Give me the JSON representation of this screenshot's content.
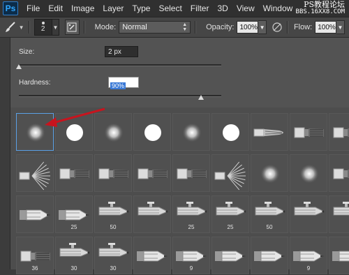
{
  "app": {
    "logo": "Ps"
  },
  "menu": [
    "File",
    "Edit",
    "Image",
    "Layer",
    "Type",
    "Select",
    "Filter",
    "3D",
    "View",
    "Window"
  ],
  "watermark": {
    "line1": "PS教程论坛",
    "line2": "BBS.16XX8.COM"
  },
  "options": {
    "brush_size": "2",
    "mode_label": "Mode:",
    "mode_value": "Normal",
    "opacity_label": "Opacity:",
    "opacity_value": "100%",
    "flow_label": "Flow:",
    "flow_value": "100%"
  },
  "brush_picker": {
    "size_label": "Size:",
    "size_value": "2 px",
    "size_slider_fraction": 0.0,
    "hardness_label": "Hardness:",
    "hardness_value": "90%",
    "hardness_slider_fraction": 0.9
  },
  "accent_colors": {
    "selection": "#3a79d6",
    "arrow": "#c8141e",
    "logo": "#31a8ff"
  },
  "brush_tiles": [
    {
      "kind": "soft",
      "label": "",
      "selected": true
    },
    {
      "kind": "hard",
      "label": ""
    },
    {
      "kind": "soft",
      "label": ""
    },
    {
      "kind": "hard",
      "label": ""
    },
    {
      "kind": "soft",
      "label": ""
    },
    {
      "kind": "hard",
      "label": ""
    },
    {
      "kind": "round-bristle",
      "label": ""
    },
    {
      "kind": "flat-bristle",
      "label": ""
    },
    {
      "kind": "flat-bristle",
      "label": ""
    },
    {
      "kind": "fan",
      "label": ""
    },
    {
      "kind": "flat-bristle",
      "label": ""
    },
    {
      "kind": "flat-bristle",
      "label": ""
    },
    {
      "kind": "flat-bristle",
      "label": ""
    },
    {
      "kind": "flat-bristle",
      "label": ""
    },
    {
      "kind": "fan",
      "label": ""
    },
    {
      "kind": "soft",
      "label": ""
    },
    {
      "kind": "soft",
      "label": ""
    },
    {
      "kind": "flat-bristle",
      "label": ""
    },
    {
      "kind": "pencil",
      "label": ""
    },
    {
      "kind": "pencil",
      "label": "25"
    },
    {
      "kind": "airbrush",
      "label": "50"
    },
    {
      "kind": "airbrush",
      "label": ""
    },
    {
      "kind": "airbrush",
      "label": "25"
    },
    {
      "kind": "airbrush",
      "label": "25"
    },
    {
      "kind": "airbrush",
      "label": "50"
    },
    {
      "kind": "airbrush",
      "label": ""
    },
    {
      "kind": "airbrush",
      "label": ""
    },
    {
      "kind": "flat-bristle",
      "label": "36"
    },
    {
      "kind": "airbrush",
      "label": "30"
    },
    {
      "kind": "airbrush",
      "label": "30"
    },
    {
      "kind": "pencil",
      "label": ""
    },
    {
      "kind": "pencil",
      "label": "9"
    },
    {
      "kind": "pencil",
      "label": ""
    },
    {
      "kind": "pencil",
      "label": ""
    },
    {
      "kind": "pencil",
      "label": "9"
    },
    {
      "kind": "pencil",
      "label": ""
    }
  ]
}
